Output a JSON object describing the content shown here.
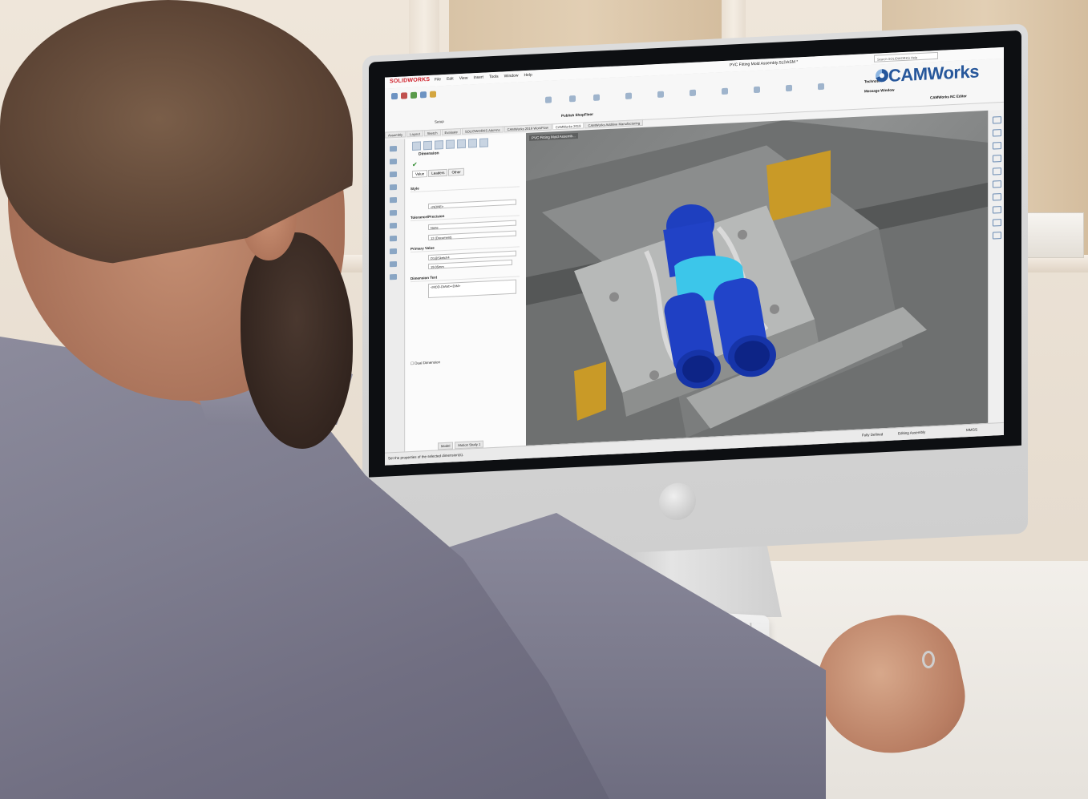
{
  "app": {
    "logo": "SOLIDWORKS",
    "menu": [
      "File",
      "Edit",
      "View",
      "Insert",
      "Tools",
      "Window",
      "Help"
    ],
    "document_title": "PVC Fitting Mold Assembly.SLDASM *",
    "search_placeholder": "Search SOLIDWORKS Help",
    "brand": "CAMWorks",
    "brand_color": "#27579b"
  },
  "ribbon": {
    "buttons": [
      "Technote",
      "Message Window",
      "CAMWorks NC Editor",
      "Publish ShopFloor",
      "Setup"
    ]
  },
  "tabs": [
    "Assembly",
    "Layout",
    "Sketch",
    "Evaluate",
    "SOLIDWORKS Add-Ins",
    "CAMWorks 2019 WorkFlow",
    "CAMWorks 2019",
    "CAMWorks Additive Manufacturing"
  ],
  "property_manager": {
    "title": "Dimension",
    "subtabs": [
      "Value",
      "Leaders",
      "Other"
    ],
    "groups": {
      "style": "Style",
      "style_value": "<NONE>",
      "tolerance": "Tolerance/Precision",
      "tolerance_value": "None",
      "precision_value": "12 (Document)",
      "primary_value": "Primary Value",
      "primary_name": "D1@Sketch4",
      "primary_number": "19.05mm",
      "dimension_text": "Dimension Text",
      "dimension_text_value": "<MOD-DIAM><DIM>",
      "dual_dimension": "Dual Dimension"
    },
    "bottom_tabs": [
      "Model",
      "Motion Study 1"
    ]
  },
  "viewport": {
    "tree_label": "PVC Fitting Mold Assemb..."
  },
  "status_bar": {
    "hint": "Set the properties of the selected dimension(s).",
    "state": "Fully Defined",
    "mode": "Editing Assembly",
    "units": "MMGS"
  }
}
